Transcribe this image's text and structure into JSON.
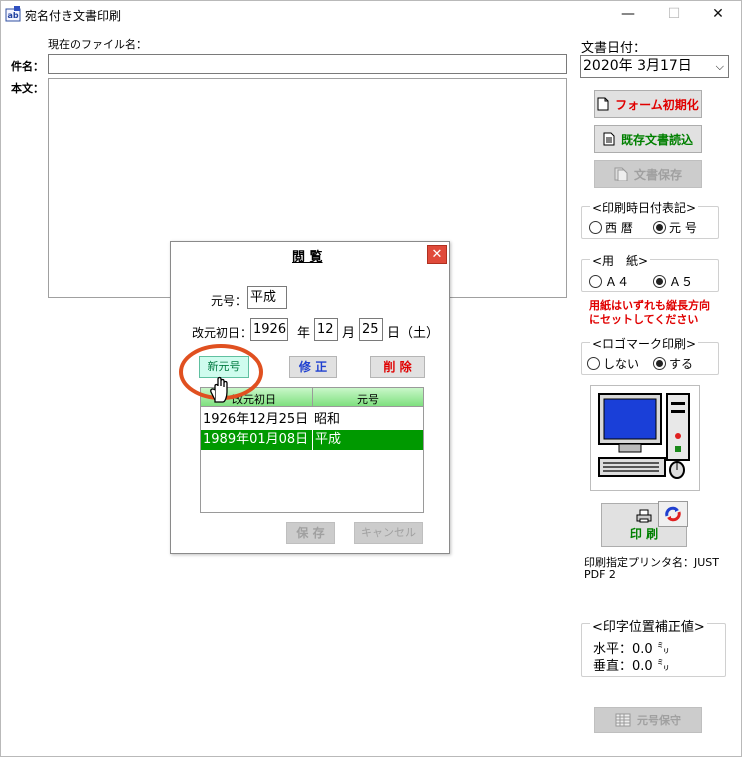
{
  "window": {
    "title": "宛名付き文書印刷",
    "minimize": "—",
    "maximize": "☐",
    "close": "✕"
  },
  "main": {
    "current_file_label": "現在のファイル名：",
    "subject_label": "件名：",
    "body_label": "本文：",
    "subject_value": "",
    "body_value": ""
  },
  "right": {
    "doc_date_label": "文書日付：",
    "doc_date_value": "2020年 3月17日",
    "btn_form_init": "フォーム初期化",
    "btn_load_doc": "既存文書読込",
    "btn_save_doc": "文書保存",
    "print_date_group": "<印刷時日付表記>",
    "opt_western": "西 暦",
    "opt_era": "元 号",
    "paper_group": "<用　紙>",
    "opt_a4": "Ａ４",
    "opt_a5": "Ａ５",
    "paper_note_1": "用紙はいずれも縦長方向",
    "paper_note_2": "にセットしてください",
    "logo_group": "<ロゴマーク印刷>",
    "opt_no": "しない",
    "opt_yes": "する",
    "print_button": "印 刷",
    "printer_label_1": "印刷指定プリンタ名：JUST",
    "printer_label_2": "PDF 2",
    "offset_group": "<印字位置補正値>",
    "horizontal": "水平：0.0 ㍉",
    "vertical": "垂直：0.0 ㍉",
    "btn_era_save": "元号保守"
  },
  "dialog": {
    "title": "閲 覧",
    "era_label": "元号：",
    "era_value": "平成",
    "start_label": "改元初日：",
    "year_value": "1926",
    "year_unit": "年",
    "month_value": "12",
    "month_unit": "月",
    "day_value": "25",
    "day_unit": "日（土）",
    "btn_new": "新元号",
    "btn_edit": "修 正",
    "btn_delete": "削 除",
    "col_date": "改元初日",
    "col_era": "元号",
    "rows": [
      {
        "date": "1926年12月25日",
        "era": "昭和"
      },
      {
        "date": "1989年01月08日",
        "era": "平成"
      }
    ],
    "btn_save": "保 存",
    "btn_cancel": "キャンセル",
    "close": "✕"
  },
  "colors": {
    "form_init_text": "#e00000",
    "load_doc_text": "#008000",
    "note_text": "#e00000",
    "selected_row": "#009900",
    "highlight_circle": "#e05020",
    "delete_text": "#e00000",
    "edit_text": "#2040d0",
    "dialog_close_bg": "#e04a3a"
  }
}
